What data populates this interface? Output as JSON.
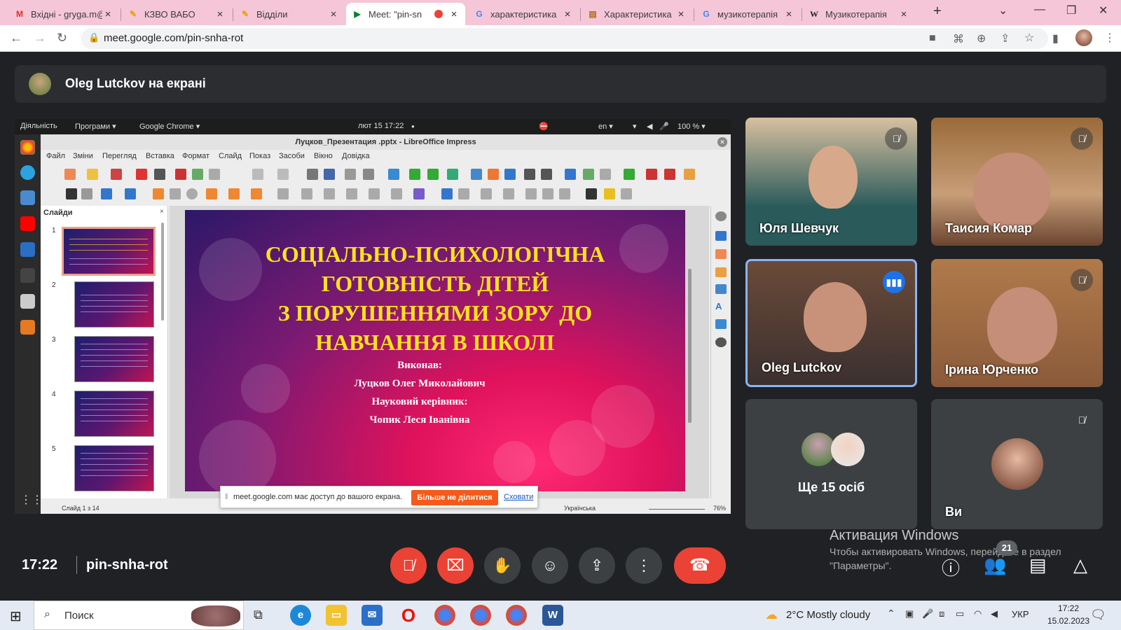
{
  "browser": {
    "tabs": [
      {
        "title": "Вхідні - gryga.m@",
        "icon": "gmail-icon"
      },
      {
        "title": "КЗВО ВАБО",
        "icon": "pen-icon"
      },
      {
        "title": "Відділи",
        "icon": "pen-icon"
      },
      {
        "title": "Meet: \"pin-sn",
        "icon": "meet-icon"
      },
      {
        "title": "характеристика",
        "icon": "google-icon"
      },
      {
        "title": "Характеристика",
        "icon": "doc-icon"
      },
      {
        "title": "музикотерапія",
        "icon": "google-icon"
      },
      {
        "title": "Музикотерапія",
        "icon": "wikipedia-icon"
      }
    ],
    "url": "meet.google.com/pin-snha-rot"
  },
  "meet": {
    "presenting": "Oleg Lutckov на екрані",
    "time": "17:22",
    "code": "pin-snha-rot",
    "participants_count": "21",
    "more_people": "Ще 15 осіб",
    "tiles": [
      {
        "name": "Юля Шевчук"
      },
      {
        "name": "Таисия Комар"
      },
      {
        "name": "Oleg Lutckov"
      },
      {
        "name": "Ірина Юрченко"
      },
      {
        "name": "Ви"
      }
    ]
  },
  "shared": {
    "gnome": {
      "activities": "Діяльність",
      "apps": "Програми ▾",
      "browser": "Google Chrome ▾",
      "clock": "лют 15  17:22",
      "lang": "en ▾",
      "battery": "100 % ▾"
    },
    "window_title": "Луцков_Презентация .pptx - LibreOffice Impress",
    "menu": [
      "Файл",
      "Зміни",
      "Перегляд",
      "Вставка",
      "Формат",
      "Слайд",
      "Показ",
      "Засоби",
      "Вікно",
      "Довідка"
    ],
    "slides_panel_title": "Слайди",
    "slide_numbers": [
      "1",
      "2",
      "3",
      "4",
      "5"
    ],
    "slide": {
      "title_lines": [
        "СОЦІАЛЬНО-ПСИХОЛОГІЧНА",
        "ГОТОВНІСТЬ ДІТЕЙ",
        "З ПОРУШЕННЯМИ ЗОРУ ДО",
        "НАВЧАННЯ В ШКОЛІ"
      ],
      "sub_lines": [
        "Виконав:",
        "Луцков Олег Миколайович",
        "Науковий керівник:",
        "Чопик Леся Іванівна"
      ]
    },
    "status": {
      "slide": "Слайд 1 з 14",
      "lang": "Українська",
      "zoom": "76%"
    },
    "share_popup": {
      "text": "meet.google.com має доступ до вашого екрана.",
      "stop": "Більше не ділитися",
      "hide": "Сховати"
    }
  },
  "windows": {
    "activation_title": "Активация Windows",
    "activation_line1": "Чтобы активировать Windows, перейдите в раздел",
    "activation_line2": "\"Параметры\"."
  },
  "taskbar": {
    "search": "Поиск",
    "weather": "2°C  Mostly cloudy",
    "lang": "УКР",
    "time": "17:22",
    "date": "15.02.2023"
  }
}
